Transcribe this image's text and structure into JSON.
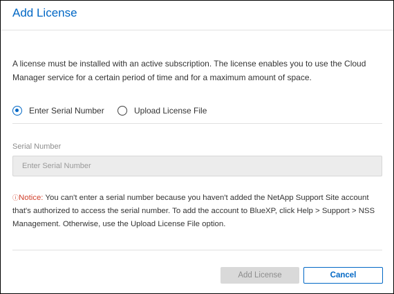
{
  "dialog": {
    "title": "Add License",
    "description": "A license must be installed with an active subscription. The license enables you to use the Cloud Manager service for a certain period of time and for a maximum amount of space.",
    "radio_options": [
      {
        "label": "Enter Serial Number",
        "selected": true
      },
      {
        "label": "Upload License File",
        "selected": false
      }
    ],
    "serial_field": {
      "label": "Serial Number",
      "placeholder": "Enter Serial Number",
      "value": ""
    },
    "notice": {
      "icon": "warning-circle-icon",
      "prefix": "Notice:",
      "text": " You can't enter a serial number because you haven't added the NetApp Support Site account that's authorized to access the serial number. To add the account to BlueXP, click Help > Support > NSS Management. Otherwise, use the Upload License File option."
    },
    "buttons": {
      "add_label": "Add License",
      "cancel_label": "Cancel"
    },
    "colors": {
      "accent": "#0067c5",
      "notice": "#d0402c",
      "disabled_bg": "#d9d9d9"
    }
  }
}
